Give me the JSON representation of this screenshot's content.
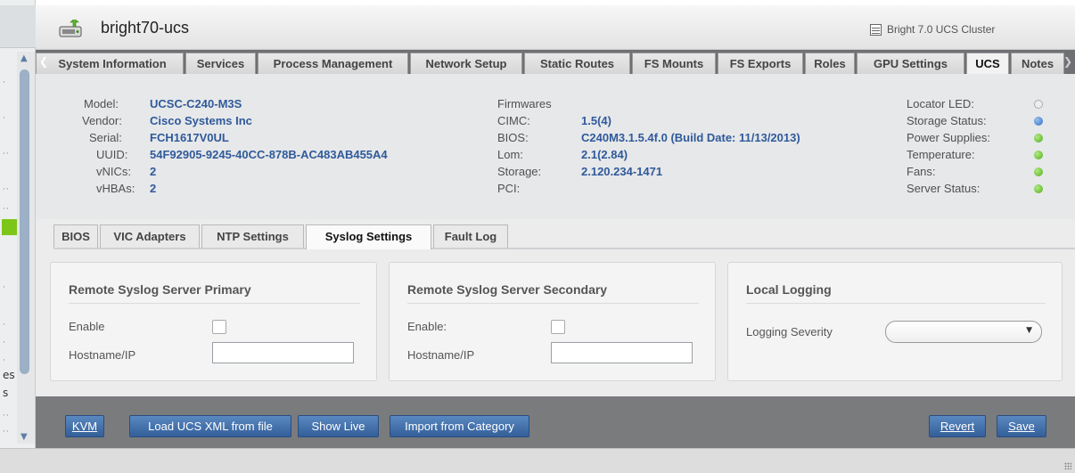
{
  "window": {
    "host_title": "bright70-ucs",
    "cluster_label": "Bright 7.0 UCS Cluster"
  },
  "left_panel": {
    "partial_words": [
      "es",
      "s"
    ],
    "accent_color": "#7cc61a"
  },
  "top_tabs": {
    "items": [
      {
        "label": "System Information"
      },
      {
        "label": "Services"
      },
      {
        "label": "Process Management"
      },
      {
        "label": "Network Setup"
      },
      {
        "label": "Static Routes"
      },
      {
        "label": "FS Mounts"
      },
      {
        "label": "FS Exports"
      },
      {
        "label": "Roles"
      },
      {
        "label": "GPU Settings"
      },
      {
        "label": "UCS"
      },
      {
        "label": "Notes"
      }
    ],
    "active": "UCS"
  },
  "server_info": {
    "model_label": "Model:",
    "model": "UCSC-C240-M3S",
    "vendor_label": "Vendor:",
    "vendor": "Cisco Systems Inc",
    "serial_label": "Serial:",
    "serial": "FCH1617V0UL",
    "uuid_label": "UUID:",
    "uuid": "54F92905-9245-40CC-878B-AC483AB455A4",
    "vnics_label": "vNICs:",
    "vnics": "2",
    "vhbas_label": "vHBAs:",
    "vhbas": "2"
  },
  "firmwares": {
    "heading": "Firmwares",
    "cimc_label": "CIMC:",
    "cimc": "1.5(4)",
    "bios_label": "BIOS:",
    "bios": "C240M3.1.5.4f.0 (Build Date: 11/13/2013)",
    "lom_label": "Lom:",
    "lom": "2.1(2.84)",
    "storage_label": "Storage:",
    "storage": "2.120.234-1471",
    "pci_label": "PCI:",
    "pci": ""
  },
  "status": {
    "locator_led": {
      "label": "Locator LED:",
      "state": "off",
      "color": "#eeeeee"
    },
    "storage_status": {
      "label": "Storage Status:",
      "state": "info",
      "color": "#2c6cc6"
    },
    "power_supplies": {
      "label": "Power Supplies:",
      "state": "ok",
      "color": "#4fae1c"
    },
    "temperature": {
      "label": "Temperature:",
      "state": "ok",
      "color": "#4fae1c"
    },
    "fans": {
      "label": "Fans:",
      "state": "ok",
      "color": "#4fae1c"
    },
    "server_status": {
      "label": "Server Status:",
      "state": "ok",
      "color": "#4fae1c"
    }
  },
  "sub_tabs": {
    "items": [
      {
        "label": "BIOS"
      },
      {
        "label": "VIC Adapters"
      },
      {
        "label": "NTP Settings"
      },
      {
        "label": "Syslog Settings"
      },
      {
        "label": "Fault Log"
      }
    ],
    "active": "Syslog Settings"
  },
  "syslog": {
    "primary": {
      "title": "Remote Syslog Server Primary",
      "enable_label": "Enable",
      "enabled": false,
      "hostname_label": "Hostname/IP",
      "hostname_value": ""
    },
    "secondary": {
      "title": "Remote Syslog Server Secondary",
      "enable_label": "Enable:",
      "enabled": false,
      "hostname_label": "Hostname/IP",
      "hostname_value": ""
    },
    "local": {
      "title": "Local Logging",
      "severity_label": "Logging Severity",
      "severity_value": ""
    }
  },
  "buttons": {
    "kvm": "KVM",
    "load_xml": "Load UCS XML from file",
    "show_live": "Show Live",
    "import_category": "Import from Category",
    "revert": "Revert",
    "save": "Save",
    "color": "#335f99"
  }
}
